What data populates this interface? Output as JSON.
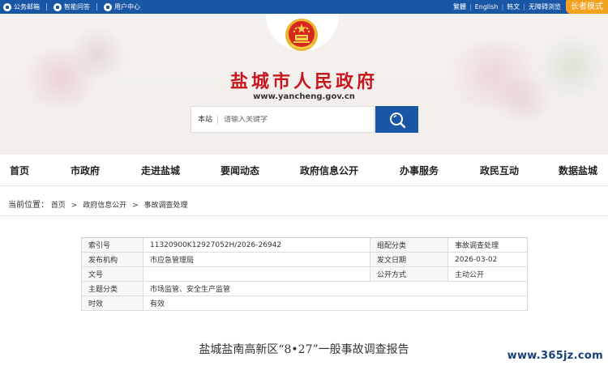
{
  "topbar": {
    "links": [
      "公务邮箱",
      "智能问答",
      "用户中心"
    ],
    "right_links": [
      "繁體",
      "English",
      "韩文",
      "无障碍浏览"
    ],
    "elder_mode": "长者模式"
  },
  "header": {
    "site_title": "盐城市人民政府",
    "site_url": "www.yancheng.gov.cn",
    "search": {
      "scope": "本站",
      "placeholder": "请输入关键字"
    }
  },
  "nav": {
    "items": [
      "首页",
      "市政府",
      "走进盐城",
      "要闻动态",
      "政府信息公开",
      "办事服务",
      "政民互动",
      "数据盐城"
    ]
  },
  "breadcrumb": {
    "label": "当前位置：",
    "items": [
      "首页",
      "政府信息公开",
      "事故调查处理"
    ],
    "sep": ">"
  },
  "info": {
    "rows": [
      {
        "k1": "索引号",
        "v1": "11320900K12927052H/2026-26942",
        "k2": "组配分类",
        "v2": "事故调查处理"
      },
      {
        "k1": "发布机构",
        "v1": "市应急管理局",
        "k2": "发文日期",
        "v2": "2026-03-02"
      },
      {
        "k1": "文号",
        "v1": "",
        "k2": "公开方式",
        "v2": "主动公开"
      },
      {
        "k1": "主题分类",
        "v1": "市场监管、安全生产监管"
      },
      {
        "k1": "时效",
        "v1": "有效"
      }
    ]
  },
  "document": {
    "title": "盐城盐南高新区“8•27”一般事故调查报告"
  },
  "watermark": "www.365jz.com",
  "colors": {
    "brand_blue": "#1a56a6",
    "title_red": "#c8161d",
    "elder_orange": "#f4a11f"
  }
}
